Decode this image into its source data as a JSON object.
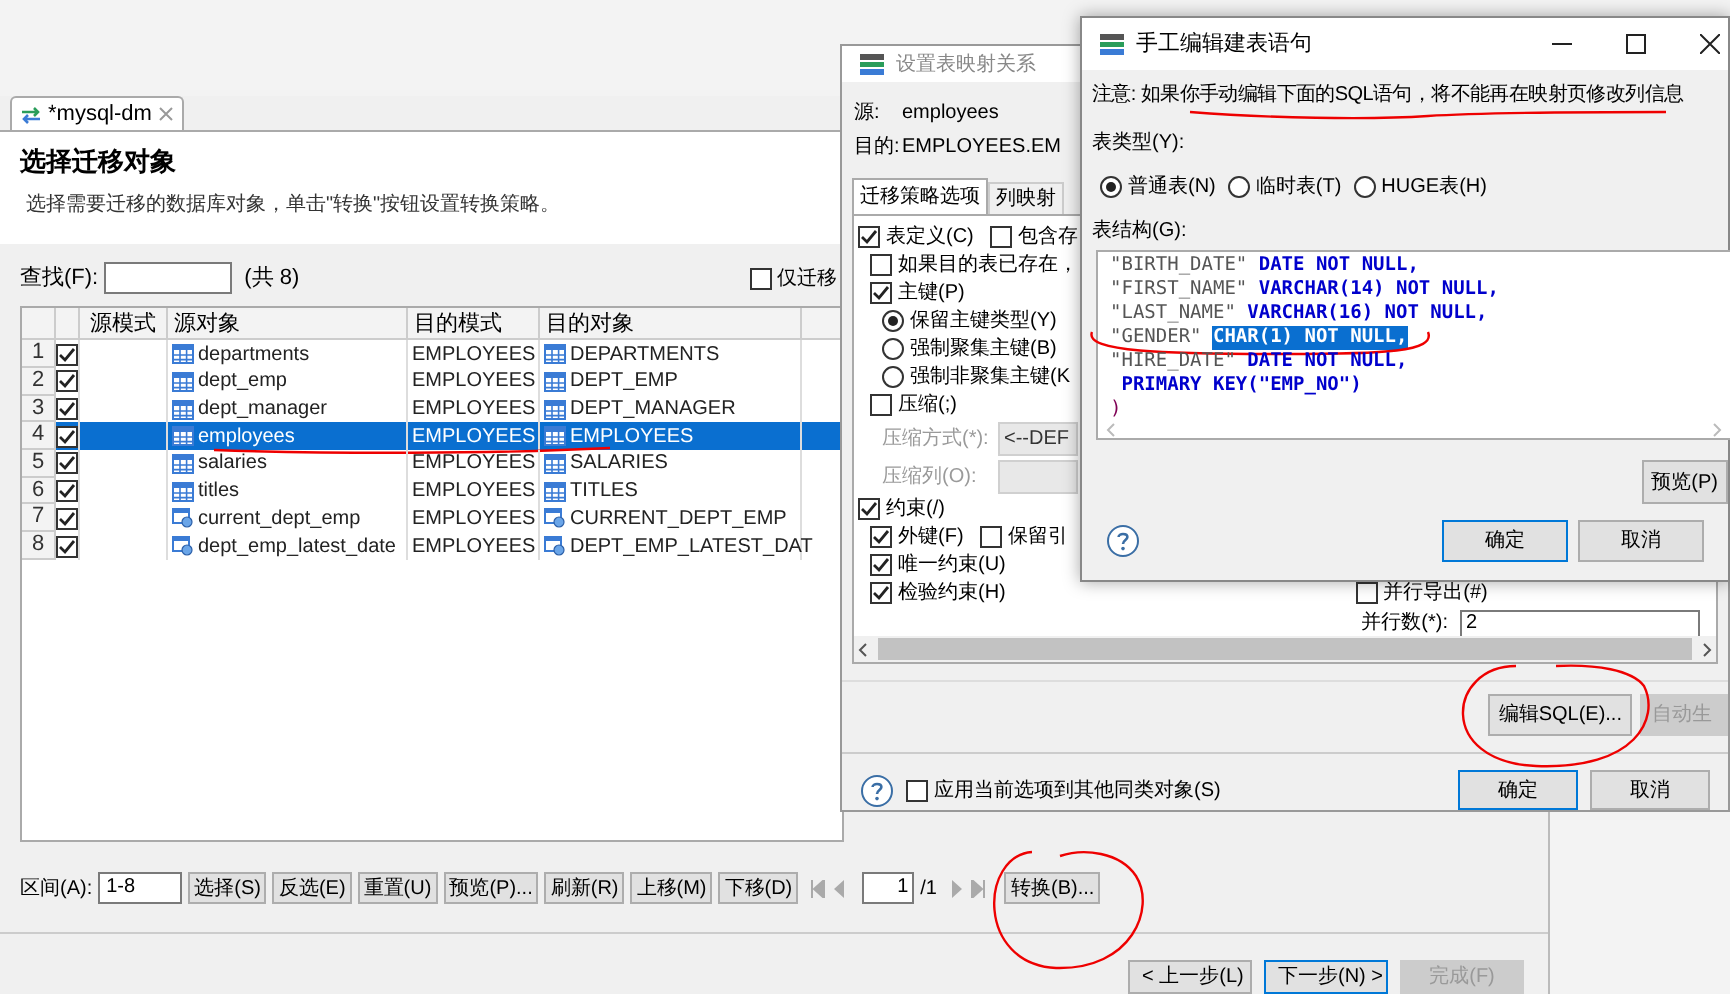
{
  "main_window": {
    "tab": "*mysql-dm",
    "title": "选择迁移对象",
    "description": "选择需要迁移的数据库对象，单击\"转换\"按钮设置转换策略。",
    "search": {
      "label": "查找(F):",
      "count": "(共 8)"
    },
    "only_checkbox": {
      "label": "仅迁移",
      "checked": false
    },
    "table": {
      "columns": [
        "源模式",
        "源对象",
        "目的模式",
        "目的对象"
      ],
      "rows": [
        {
          "number": "1",
          "checked": true,
          "selected": false,
          "kind": "table",
          "source_object": "departments",
          "target_schema": "EMPLOYEES",
          "target_object": "DEPARTMENTS"
        },
        {
          "number": "2",
          "checked": true,
          "selected": false,
          "kind": "table",
          "source_object": "dept_emp",
          "target_schema": "EMPLOYEES",
          "target_object": "DEPT_EMP"
        },
        {
          "number": "3",
          "checked": true,
          "selected": false,
          "kind": "table",
          "source_object": "dept_manager",
          "target_schema": "EMPLOYEES",
          "target_object": "DEPT_MANAGER"
        },
        {
          "number": "4",
          "checked": true,
          "selected": true,
          "kind": "table",
          "source_object": "employees",
          "target_schema": "EMPLOYEES",
          "target_object": "EMPLOYEES"
        },
        {
          "number": "5",
          "checked": true,
          "selected": false,
          "kind": "table",
          "source_object": "salaries",
          "target_schema": "EMPLOYEES",
          "target_object": "SALARIES"
        },
        {
          "number": "6",
          "checked": true,
          "selected": false,
          "kind": "table",
          "source_object": "titles",
          "target_schema": "EMPLOYEES",
          "target_object": "TITLES"
        },
        {
          "number": "7",
          "checked": true,
          "selected": false,
          "kind": "view",
          "source_object": "current_dept_emp",
          "target_schema": "EMPLOYEES",
          "target_object": "CURRENT_DEPT_EMP"
        },
        {
          "number": "8",
          "checked": true,
          "selected": false,
          "kind": "view",
          "source_object": "dept_emp_latest_date",
          "target_schema": "EMPLOYEES",
          "target_object": "DEPT_EMP_LATEST_DAT"
        }
      ]
    },
    "range": {
      "label": "区间(A):",
      "value": "1-8"
    },
    "buttons": [
      "选择(S)",
      "反选(E)",
      "重置(U)",
      "预览(P)...",
      "刷新(R)",
      "上移(M)",
      "下移(D)"
    ],
    "pager": {
      "page": "1",
      "total": "/1"
    },
    "convert_button": "转换(B)...",
    "wizard_buttons": [
      {
        "label": "< 上一步(L)",
        "disabled": false,
        "default": false
      },
      {
        "label": "下一步(N) >",
        "disabled": false,
        "default": true
      },
      {
        "label": "完成(F)",
        "disabled": true,
        "default": false
      }
    ]
  },
  "mapping_dialog": {
    "title": "设置表映射关系",
    "source": {
      "label": "源:",
      "value": "employees"
    },
    "target": {
      "label": "目的:",
      "value": "EMPLOYEES.EM"
    },
    "tabs": [
      {
        "label": "迁移策略选项",
        "selected": true
      },
      {
        "label": "列映射",
        "selected": false
      }
    ],
    "options": [
      {
        "kind": "checkbox",
        "label": "表定义(C)",
        "checked": true,
        "extra": {
          "label": "包含存",
          "checked": false
        },
        "children": [
          {
            "kind": "checkbox",
            "label": "如果目的表已存在，",
            "checked": false
          },
          {
            "kind": "checkbox",
            "label": "主键(P)",
            "checked": true,
            "children": [
              {
                "kind": "radio",
                "label": "保留主键类型(Y)",
                "selected": true
              },
              {
                "kind": "radio",
                "label": "强制聚集主键(B)",
                "selected": false
              },
              {
                "kind": "radio",
                "label": "强制非聚集主键(K",
                "selected": false
              }
            ]
          },
          {
            "kind": "checkbox",
            "label": "压缩(;)",
            "checked": false,
            "children": [
              {
                "kind": "field",
                "label": "压缩方式(*):",
                "value": "<--DEF",
                "disabled": true
              },
              {
                "kind": "field",
                "label": "压缩列(O):",
                "disabled": true
              }
            ]
          }
        ]
      },
      {
        "kind": "checkbox",
        "label": "约束(/)",
        "checked": true,
        "children": [
          {
            "kind": "checkbox",
            "label": "外键(F)",
            "checked": true,
            "extra": {
              "label": "保留引",
              "checked": false
            }
          },
          {
            "kind": "checkbox",
            "label": "唯一约束(U)",
            "checked": true
          },
          {
            "kind": "checkbox",
            "label": "检验约束(H)",
            "checked": true
          }
        ]
      }
    ],
    "parallel_export": {
      "label": "并行导出(#)",
      "checked": false
    },
    "parallel_count": {
      "label": "并行数(*):",
      "value": "2"
    },
    "edit_sql_button": "编辑SQL(E)...",
    "auto_button": {
      "label": "自动生",
      "disabled": true
    },
    "apply_all": {
      "label": "应用当前选项到其他同类对象(S)",
      "checked": false
    },
    "buttons": [
      {
        "label": "确定",
        "default": true
      },
      {
        "label": "取消",
        "default": false
      }
    ]
  },
  "sql_dialog": {
    "title": "手工编辑建表语句",
    "note": "注意: 如果你手动编辑下面的SQL语句，将不能再在映射页修改列信息",
    "table_type_label": "表类型(Y):",
    "table_types": [
      {
        "label": "普通表(N)",
        "selected": true
      },
      {
        "label": "临时表(T)",
        "selected": false
      },
      {
        "label": "HUGE表(H)",
        "selected": false
      }
    ],
    "structure_label": "表结构(G):",
    "sql_lines": [
      [
        {
          "text": "\"BIRTH_DATE\" ",
          "kind": "name",
          "selected": false
        },
        {
          "text": "DATE NOT NULL,",
          "kind": "keyword",
          "selected": false
        }
      ],
      [
        {
          "text": "\"FIRST_NAME\" ",
          "kind": "name",
          "selected": false
        },
        {
          "text": "VARCHAR(14) NOT NULL,",
          "kind": "keyword",
          "selected": false
        }
      ],
      [
        {
          "text": "\"LAST_NAME\" ",
          "kind": "name",
          "selected": false
        },
        {
          "text": "VARCHAR(16) NOT NULL,",
          "kind": "keyword",
          "selected": false
        }
      ],
      [
        {
          "text": "\"GENDER\" ",
          "kind": "name",
          "selected": false
        },
        {
          "text": "CHAR(1) NOT NULL,",
          "kind": "keyword",
          "selected": true
        }
      ],
      [
        {
          "text": "\"HIRE_DATE\" ",
          "kind": "name",
          "selected": false
        },
        {
          "text": "DATE NOT NULL,",
          "kind": "keyword",
          "selected": false
        }
      ],
      [
        {
          "text": " PRIMARY KEY(\"EMP_NO\")",
          "kind": "keyword",
          "selected": false
        }
      ],
      [
        {
          "text": ")",
          "kind": "plain",
          "selected": false
        }
      ]
    ],
    "preview_button": "预览(P)",
    "buttons": [
      {
        "label": "确定",
        "default": true
      },
      {
        "label": "取消",
        "default": false
      }
    ]
  }
}
